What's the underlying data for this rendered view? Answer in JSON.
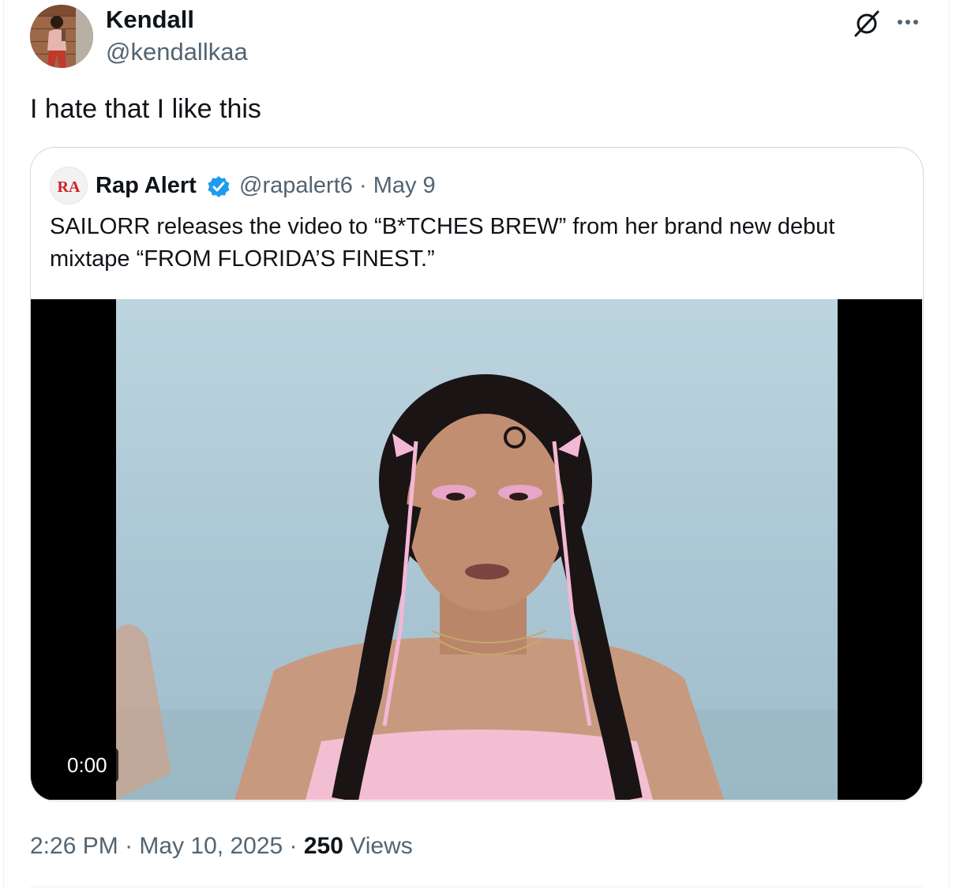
{
  "author": {
    "name": "Kendall",
    "handle": "@kendallkaa"
  },
  "icons": {
    "grok": "grok-icon",
    "more": "more-icon",
    "verified": "verified-badge-icon"
  },
  "tweet": {
    "text": "I hate that I like this"
  },
  "quoted": {
    "name": "Rap Alert",
    "logo_text": "RA",
    "handle": "@rapalert6",
    "separator": " · ",
    "date": "May 9",
    "text": "SAILORR releases the video to “B*TCHES BREW” from her brand new debut mixtape “FROM FLORIDA’S FINEST.”",
    "video_time": "0:00"
  },
  "footer": {
    "time": "2:26 PM",
    "separator": " · ",
    "date": "May 10, 2025",
    "views_count": "250",
    "views_label": "Views"
  },
  "colors": {
    "text": "#0f1419",
    "muted": "#536471",
    "border": "#cfd9de",
    "verified": "#1d9bf0"
  }
}
